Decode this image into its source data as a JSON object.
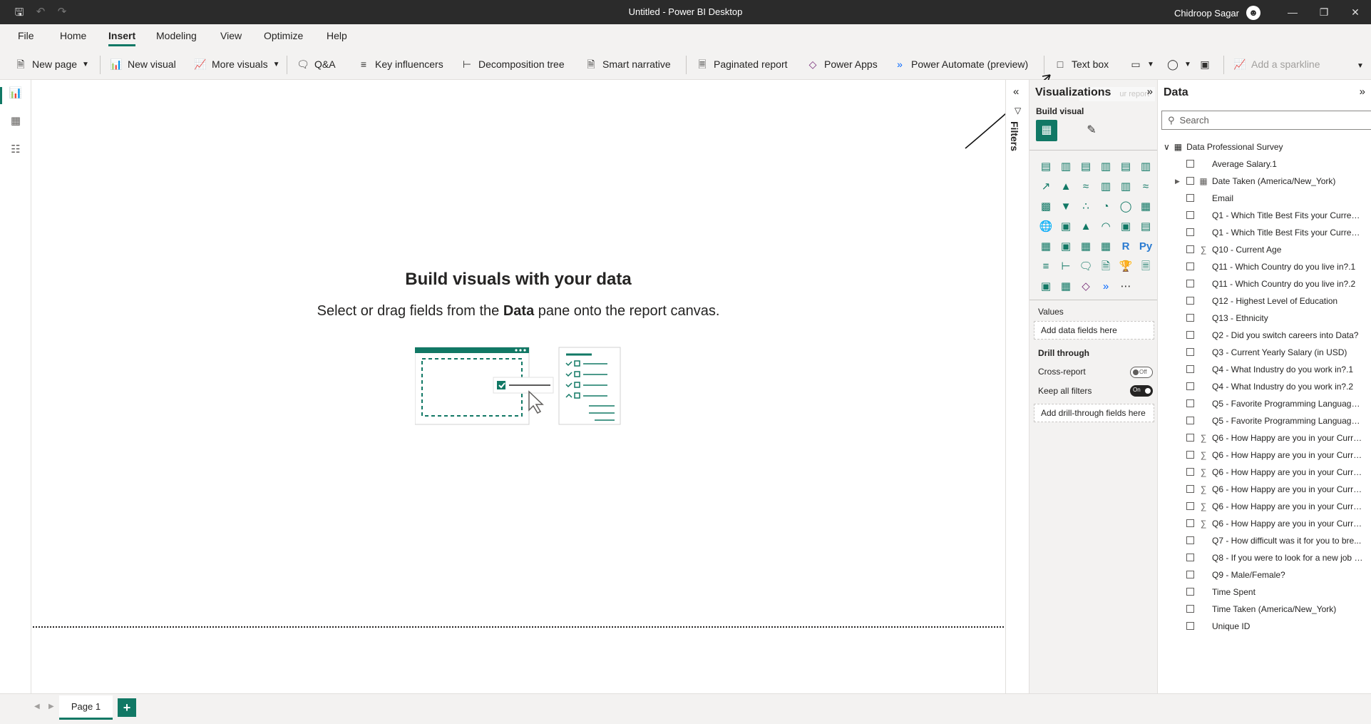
{
  "window": {
    "title": "Untitled - Power BI Desktop",
    "user": "Chidroop Sagar",
    "controls": [
      "—",
      "❐",
      "✕"
    ]
  },
  "menu": {
    "tabs": [
      "File",
      "Home",
      "Insert",
      "Modeling",
      "View",
      "Optimize",
      "Help"
    ],
    "active": "Insert"
  },
  "ribbon": {
    "new_page": "New page",
    "new_visual": "New visual",
    "more_visuals": "More visuals",
    "qna": "Q&A",
    "key_influencers": "Key influencers",
    "decomposition_tree": "Decomposition tree",
    "smart_narrative": "Smart narrative",
    "paginated_report": "Paginated report",
    "power_apps": "Power Apps",
    "power_automate": "Power Automate (preview)",
    "text_box": "Text box",
    "add_sparkline": "Add a sparkline"
  },
  "canvas": {
    "heading": "Build visuals with your data",
    "sub_pre": "Select or drag fields from the ",
    "sub_bold": "Data",
    "sub_post": " pane onto the report canvas."
  },
  "pages": {
    "tabs": [
      "Page 1"
    ],
    "add": "+"
  },
  "filters": {
    "label": "Filters"
  },
  "visualizations": {
    "title": "Visualizations",
    "tooltip": "ur report",
    "build_visual": "Build visual",
    "values_label": "Values",
    "values_placeholder": "Add data fields here",
    "drill_through": "Drill through",
    "cross_report": "Cross-report",
    "cross_report_state": "Off",
    "keep_all_filters": "Keep all filters",
    "keep_all_filters_state": "On",
    "drill_placeholder": "Add drill-through fields here",
    "grid_r_label": "R",
    "grid_py_label": "Py",
    "grid_more_label": "⋯"
  },
  "data_pane": {
    "title": "Data",
    "search_placeholder": "Search",
    "table_name": "Data Professional Survey",
    "fields": [
      {
        "name": "Average Salary.1",
        "type": ""
      },
      {
        "name": "Date Taken (America/New_York)",
        "type": "calendar",
        "expandable": true
      },
      {
        "name": "Email",
        "type": ""
      },
      {
        "name": "Q1 - Which Title Best Fits your Current ...",
        "type": ""
      },
      {
        "name": "Q1 - Which Title Best Fits your Current ...",
        "type": ""
      },
      {
        "name": "Q10 - Current Age",
        "type": "sigma"
      },
      {
        "name": "Q11 - Which Country do you live in?.1",
        "type": ""
      },
      {
        "name": "Q11 - Which Country do you live in?.2",
        "type": ""
      },
      {
        "name": "Q12 - Highest Level of Education",
        "type": ""
      },
      {
        "name": "Q13 - Ethnicity",
        "type": ""
      },
      {
        "name": "Q2 - Did you switch careers into Data?",
        "type": ""
      },
      {
        "name": "Q3 - Current Yearly Salary (in USD)",
        "type": ""
      },
      {
        "name": "Q4 - What Industry do you work in?.1",
        "type": ""
      },
      {
        "name": "Q4 - What Industry do you work in?.2",
        "type": ""
      },
      {
        "name": "Q5 - Favorite Programming Language.1",
        "type": ""
      },
      {
        "name": "Q5 - Favorite Programming Language.2",
        "type": ""
      },
      {
        "name": "Q6 - How Happy are you in your Curre...",
        "type": "sigma"
      },
      {
        "name": "Q6 - How Happy are you in your Curre...",
        "type": "sigma"
      },
      {
        "name": "Q6 - How Happy are you in your Curre...",
        "type": "sigma"
      },
      {
        "name": "Q6 - How Happy are you in your Curre...",
        "type": "sigma"
      },
      {
        "name": "Q6 - How Happy are you in your Curre...",
        "type": "sigma"
      },
      {
        "name": "Q6 - How Happy are you in your Curre...",
        "type": "sigma"
      },
      {
        "name": "Q7 - How difficult was it for you to bre...",
        "type": ""
      },
      {
        "name": "Q8 - If you were to look for a new job t...",
        "type": ""
      },
      {
        "name": "Q9 - Male/Female?",
        "type": ""
      },
      {
        "name": "Time Spent",
        "type": ""
      },
      {
        "name": "Time Taken (America/New_York)",
        "type": ""
      },
      {
        "name": "Unique ID",
        "type": ""
      }
    ]
  },
  "colors": {
    "accent": "#117865",
    "titlebar": "#2b2b2b",
    "pane": "#f3f2f1"
  }
}
